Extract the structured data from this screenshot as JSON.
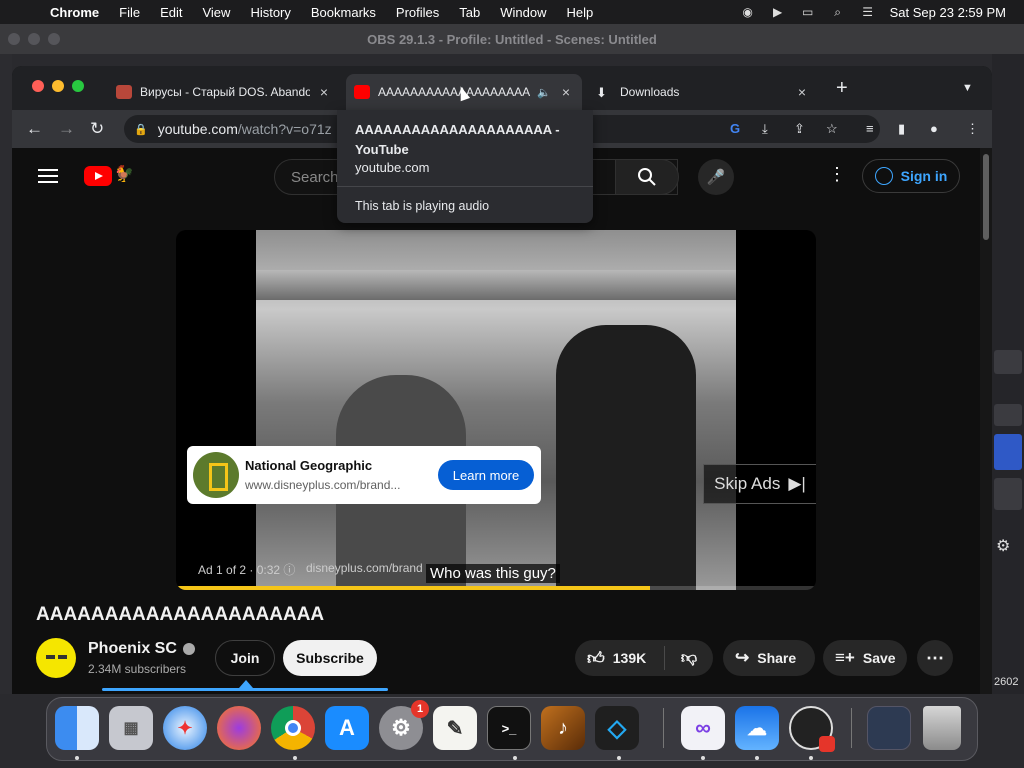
{
  "menubar": {
    "app": "Chrome",
    "items": [
      "File",
      "Edit",
      "View",
      "History",
      "Bookmarks",
      "Profiles",
      "Tab",
      "Window",
      "Help"
    ],
    "datetime": "Sat Sep 23  2:59 PM"
  },
  "obs": {
    "title": "OBS 29.1.3 - Profile: Untitled - Scenes: Untitled",
    "side_number": "2602"
  },
  "tabs": [
    {
      "title": "Вирусы - Старый DOS. Abandonware"
    },
    {
      "title": "AAAAAAAAAAAAAAAAAAAA"
    },
    {
      "title": "Downloads"
    }
  ],
  "toolbar": {
    "url_host": "youtube.com",
    "url_path": "/watch?v=o71z"
  },
  "hover_card": {
    "title": "AAAAAAAAAAAAAAAAAAAAA - YouTube",
    "domain": "youtube.com",
    "audio": "This tab is playing audio"
  },
  "youtube": {
    "search_placeholder": "Search",
    "sign_in": "Sign in",
    "ad": {
      "advertiser": "National Geographic",
      "url": "www.disneyplus.com/brand...",
      "cta": "Learn more",
      "skip": "Skip Ads",
      "info": "Ad 1 of 2 · 0:32",
      "info_url": "disneyplus.com/brand",
      "progress": 0.74
    },
    "caption": "Who was this guy?",
    "video_title": "AAAAAAAAAAAAAAAAAAAAA",
    "channel": {
      "name": "Phoenix SC",
      "subscribers": "2.34M subscribers"
    },
    "join": "Join",
    "subscribe": "Subscribe",
    "likes": "139K",
    "share": "Share",
    "save": "Save"
  },
  "colors": {
    "yt_red": "#ff0000",
    "accent_blue": "#3ea6ff",
    "progress_yellow": "#f5c518"
  },
  "dock": [
    "finder-icon",
    "launchpad-icon",
    "safari-icon",
    "firefox-icon",
    "chrome-icon",
    "app-store-icon",
    "system-settings-icon",
    "textedit-icon",
    "terminal-icon",
    "garageband-icon",
    "vscode-icon",
    "visual-studio-icon",
    "icloud-icon",
    "obs-icon",
    "screenshot-icon",
    "trash-icon"
  ],
  "dock_badge": "1"
}
